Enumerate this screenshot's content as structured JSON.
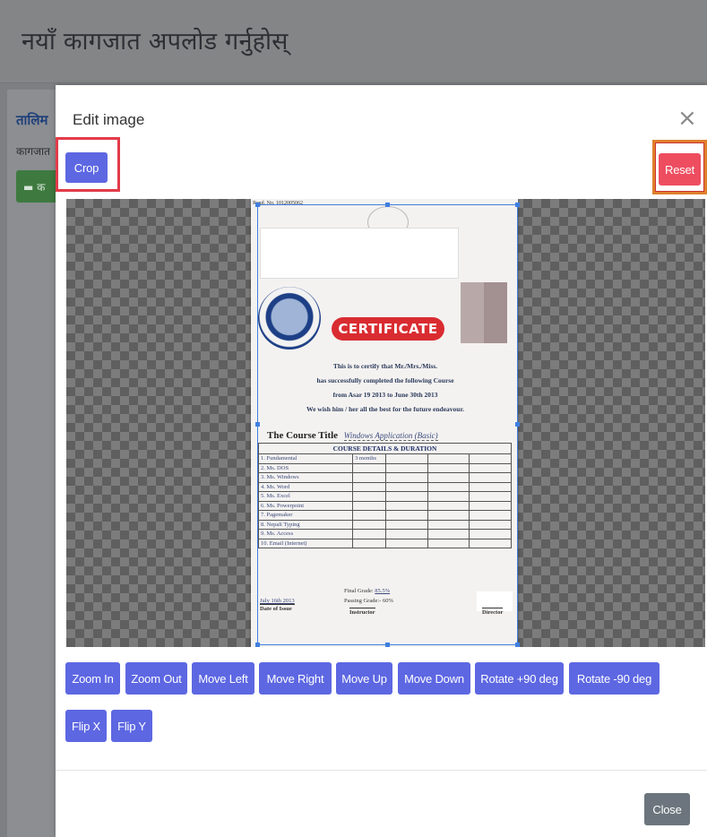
{
  "page": {
    "title": "नयाँ कागजात अपलोड गर्नुहोस्",
    "background_link": "तालिम",
    "background_text": "कागजात",
    "background_button": "▬ क"
  },
  "modal": {
    "title": "Edit image",
    "close_icon": "×",
    "crop_label": "Crop",
    "reset_label": "Reset",
    "close_label": "Close",
    "toolbar": [
      {
        "label": "Zoom In"
      },
      {
        "label": "Zoom Out"
      },
      {
        "label": "Move Left"
      },
      {
        "label": "Move Right"
      },
      {
        "label": "Move Up"
      },
      {
        "label": "Move Down"
      },
      {
        "label": "Rotate +90 deg"
      },
      {
        "label": "Rotate -90 deg"
      },
      {
        "label": "Flip X"
      },
      {
        "label": "Flip Y"
      }
    ]
  },
  "certificate": {
    "reg_no": "Regd. No. 1012005062",
    "banner": "CERTIFICATE",
    "lines": [
      "This is to certify that Mr./Mrs./Miss.",
      "has successfully completed the following Course",
      "from Asar 19 2013 to June 30th 2013",
      "We wish him / her all the best for the future endeavour."
    ],
    "course_title_label": "The Course Title",
    "course_title_value": "Windows Application (Basic)",
    "table_header": "COURSE DETAILS & DURATION",
    "first_row_extra": "3 months",
    "table_rows": [
      "1. Fundamental",
      "2. Ms. DOS",
      "3. Ms. Windows",
      "4. Ms. Word",
      "5. Ms. Excel",
      "6. Ms. Powerpoint",
      "7. Pagemaker",
      "8. Nepali Typing",
      "9. Ms. Access",
      "10. Email (Internet)"
    ],
    "final_grade_label": "Final Grade:",
    "final_grade_value": "85.5%",
    "passing_grade": "Passing Grade:- 60%",
    "date_value": "July 16th 2013",
    "date_label": "Date of Issue",
    "instructor_label": "Instructor",
    "director_label": "Director"
  },
  "colors": {
    "primary": "#5d67e2",
    "danger": "#ee4d60",
    "secondary": "#6c757d",
    "highlight": "#e23b49"
  }
}
